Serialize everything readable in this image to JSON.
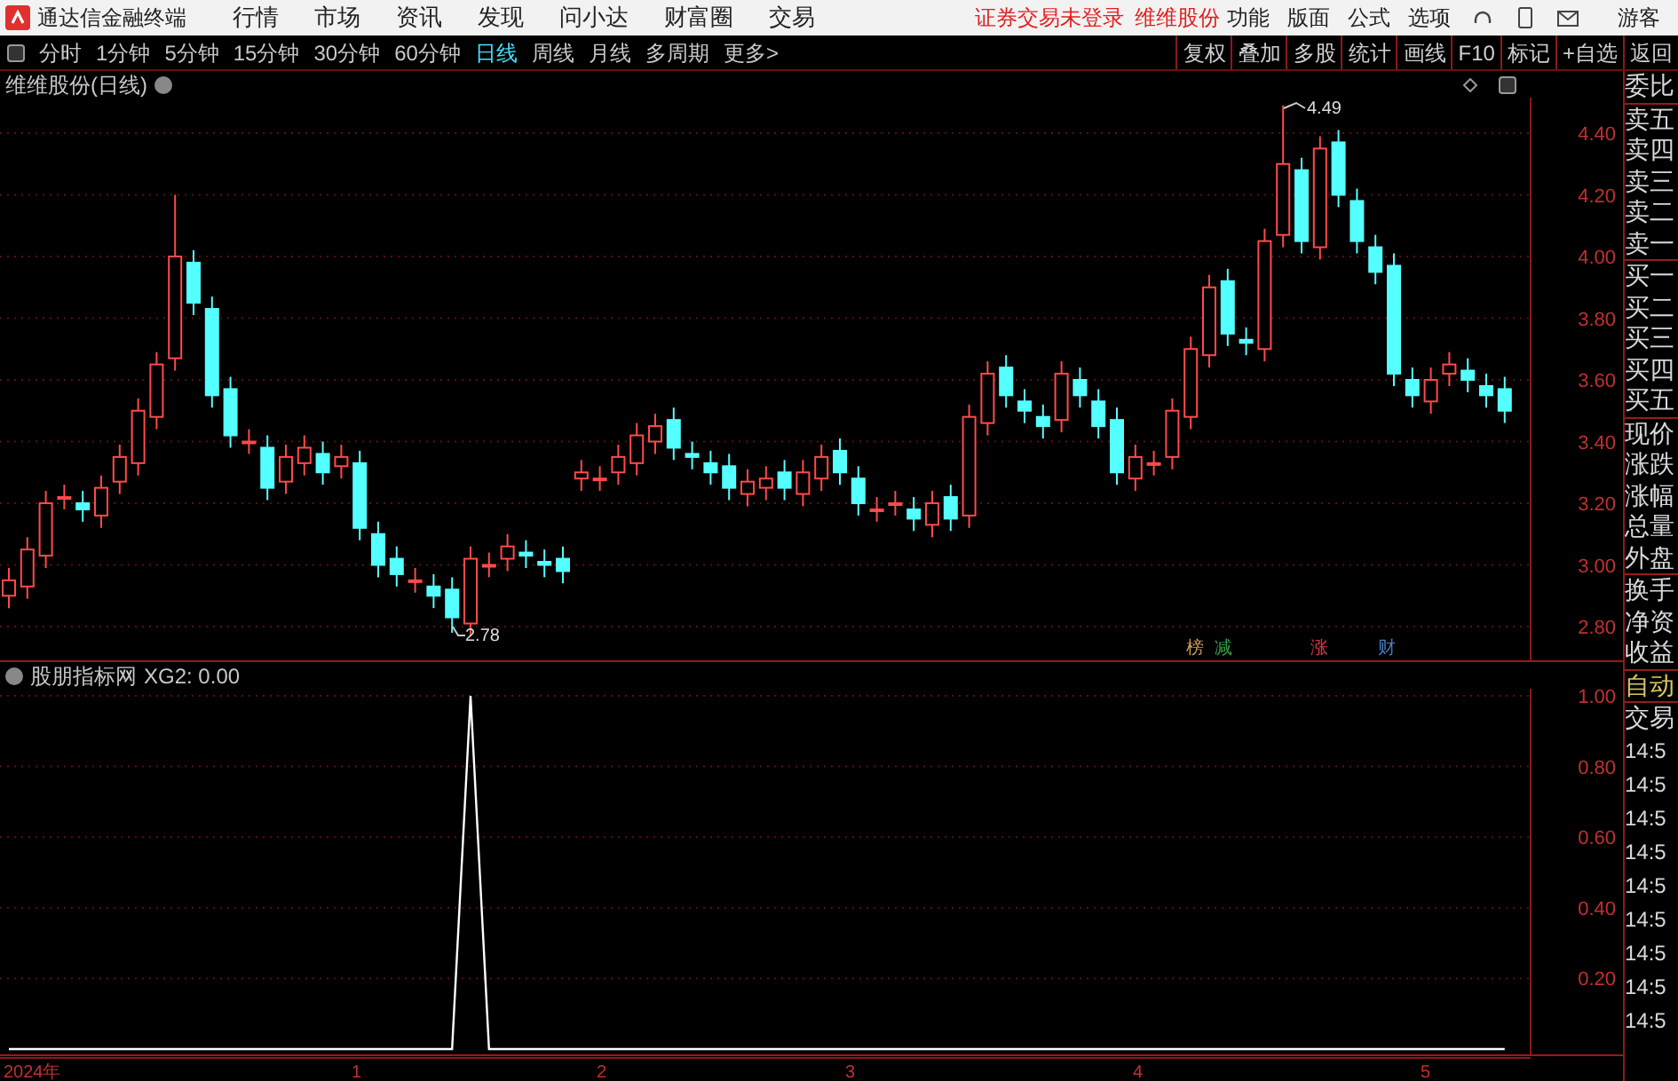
{
  "top_bar": {
    "app_name": "通达信金融终端",
    "menus": [
      "行情",
      "市场",
      "资讯",
      "发现",
      "问小达",
      "财富圈",
      "交易"
    ],
    "notice": "证券交易未登录",
    "stock": "维维股份",
    "tools": [
      "功能",
      "版面",
      "公式",
      "选项"
    ],
    "user": "游客"
  },
  "toolbar": {
    "periods": [
      {
        "label": "分时",
        "selected": false
      },
      {
        "label": "1分钟",
        "selected": false
      },
      {
        "label": "5分钟",
        "selected": false
      },
      {
        "label": "15分钟",
        "selected": false
      },
      {
        "label": "30分钟",
        "selected": false
      },
      {
        "label": "60分钟",
        "selected": false
      },
      {
        "label": "日线",
        "selected": true
      },
      {
        "label": "周线",
        "selected": false
      },
      {
        "label": "月线",
        "selected": false
      },
      {
        "label": "多周期",
        "selected": false
      }
    ],
    "more": "更多>",
    "buttons": [
      "复权",
      "叠加",
      "多股",
      "统计",
      "画线",
      "F10",
      "标记",
      "+自选",
      "返回"
    ]
  },
  "price_chart": {
    "title": "维维股份(日线)",
    "high_label": "4.49",
    "low_label": "2.78",
    "price_labels": [
      "4.40",
      "4.20",
      "4.00",
      "3.80",
      "3.60",
      "3.40",
      "3.20",
      "3.00",
      "2.80"
    ],
    "event_tags": [
      {
        "label": "榜",
        "color": "#c89a5a"
      },
      {
        "label": "减",
        "color": "#3aa04a"
      },
      {
        "label": "涨",
        "color": "#d8384a"
      },
      {
        "label": "财",
        "color": "#4a7ec0"
      }
    ]
  },
  "indicator_chart": {
    "title": "股朋指标网",
    "readout": ": 0.00",
    "chart_data": {
      "type": "line",
      "grid": true,
      "ylim": [
        -0.02,
        1.0
      ],
      "yticks": [
        {
          "value": 1.0,
          "label": "1.00"
        },
        {
          "value": 0.8,
          "label": "0.80"
        },
        {
          "value": 0.6,
          "label": "0.60"
        },
        {
          "value": 0.4,
          "label": "0.40"
        },
        {
          "value": 0.2,
          "label": "0.20"
        }
      ],
      "series": [
        {
          "name": "XG2",
          "color": "#ffffff",
          "values": [
            0,
            0,
            0,
            0,
            0,
            0,
            0,
            0,
            0,
            0,
            0,
            0,
            0,
            0,
            0,
            0,
            0,
            0,
            0,
            0,
            0,
            0,
            0,
            0,
            0,
            1,
            0,
            0,
            0,
            0,
            0,
            0,
            0,
            0,
            0,
            0,
            0,
            0,
            0,
            0,
            0,
            0,
            0,
            0,
            0,
            0,
            0,
            0,
            0,
            0,
            0,
            0,
            0,
            0,
            0,
            0,
            0,
            0,
            0,
            0,
            0,
            0,
            0,
            0,
            0,
            0,
            0,
            0,
            0,
            0,
            0,
            0,
            0,
            0,
            0,
            0,
            0,
            0,
            0,
            0,
            0,
            0
          ]
        }
      ]
    }
  },
  "time_axis": [
    "2024年",
    "1",
    "2",
    "3",
    "4",
    "5"
  ],
  "quote_panel": {
    "groups": [
      [
        "委比"
      ],
      [
        "卖五",
        "卖四",
        "卖三",
        "卖二",
        "卖一"
      ],
      [
        "买一",
        "买二",
        "买三",
        "买四",
        "买五"
      ],
      [
        "现价",
        "涨跌",
        "涨幅",
        "总量",
        "外盘"
      ],
      [
        "换手",
        "净资",
        "收益"
      ]
    ],
    "mode_button": "自动",
    "trade_label": "交易",
    "times": [
      "14:5",
      "14:5",
      "14:5",
      "14:5",
      "14:5",
      "14:5",
      "14:5",
      "14:5",
      "14:5"
    ]
  }
}
